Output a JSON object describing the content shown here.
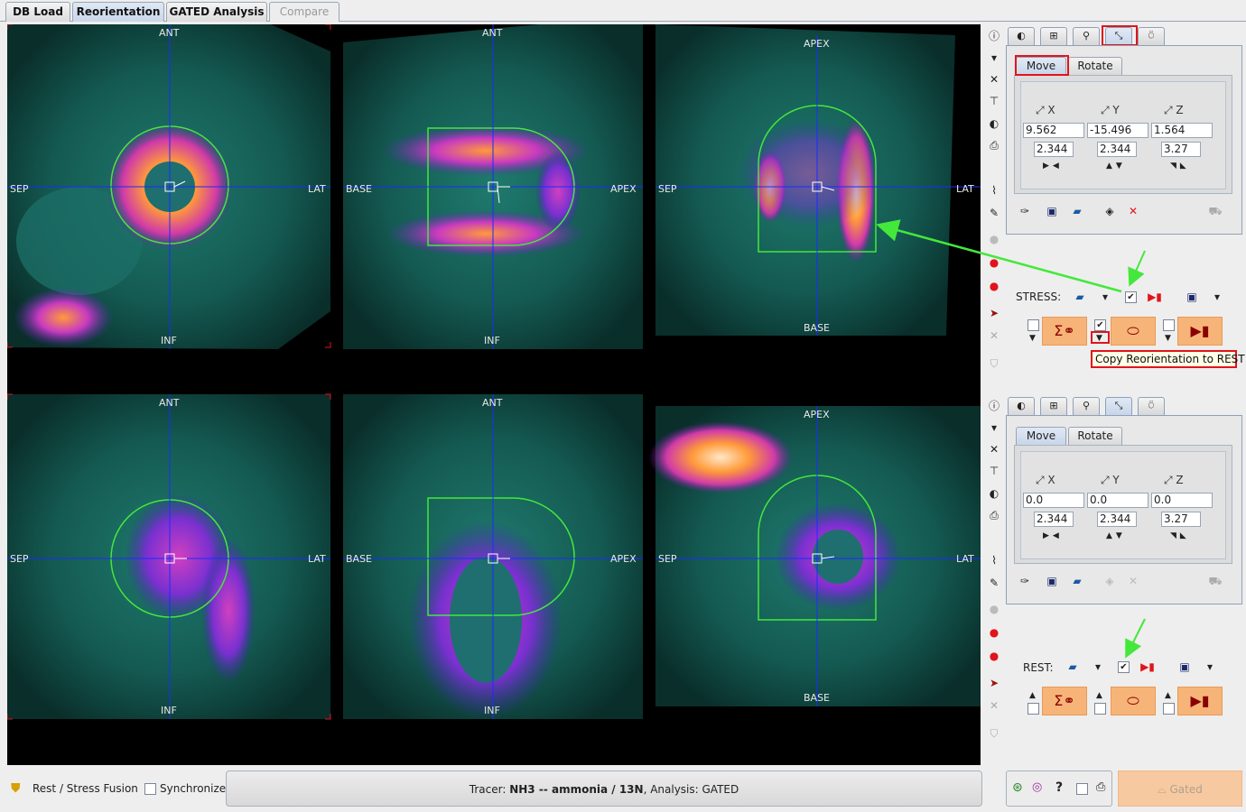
{
  "tabs": [
    {
      "label": "DB Load",
      "state": "normal"
    },
    {
      "label": "Reorientation",
      "state": "active"
    },
    {
      "label": "GATED Analysis",
      "state": "normal"
    },
    {
      "label": "Compare",
      "state": "disabled"
    }
  ],
  "viewports": {
    "stress": [
      {
        "top": "ANT",
        "bottom": "INF",
        "left": "SEP",
        "right": "LAT"
      },
      {
        "top": "ANT",
        "bottom": "INF",
        "left": "BASE",
        "right": "APEX"
      },
      {
        "top": "APEX",
        "bottom": "BASE",
        "left": "SEP",
        "right": "LAT"
      }
    ],
    "rest": [
      {
        "top": "ANT",
        "bottom": "INF",
        "left": "SEP",
        "right": "LAT"
      },
      {
        "top": "ANT",
        "bottom": "INF",
        "left": "BASE",
        "right": "APEX"
      },
      {
        "top": "APEX",
        "bottom": "BASE",
        "left": "SEP",
        "right": "LAT"
      }
    ]
  },
  "stress_panel": {
    "subtabs": [
      "Move",
      "Rotate"
    ],
    "axes": [
      "X",
      "Y",
      "Z"
    ],
    "position": [
      "9.562",
      "-15.496",
      "1.564"
    ],
    "step": [
      "2.344",
      "2.344",
      "3.27"
    ],
    "label": "STRESS:",
    "tooltip": "Copy Reorientation to REST"
  },
  "rest_panel": {
    "subtabs": [
      "Move",
      "Rotate"
    ],
    "axes": [
      "X",
      "Y",
      "Z"
    ],
    "position": [
      "0.0",
      "0.0",
      "0.0"
    ],
    "step": [
      "2.344",
      "2.344",
      "3.27"
    ],
    "label": "REST:"
  },
  "bottom": {
    "fusion_label": "Rest / Stress Fusion",
    "sync_label": "Synchronize",
    "status_prefix": "Tracer:",
    "status_tracer": "NH3 -- ammonia / 13N",
    "status_suffix": ", Analysis: GATED",
    "gated_label": "Gated",
    "help_label": "?"
  },
  "colors": {
    "crosshair": "#1a2cff",
    "contour": "#44e83a",
    "highlight": "#e0141c",
    "button_orange": "#f7b478"
  },
  "icons": [
    "info-icon",
    "close-icon",
    "folder-open-icon",
    "save-icon",
    "sum-icon",
    "chevron-down-icon",
    "checkbox-icon",
    "print-icon",
    "help-icon"
  ]
}
